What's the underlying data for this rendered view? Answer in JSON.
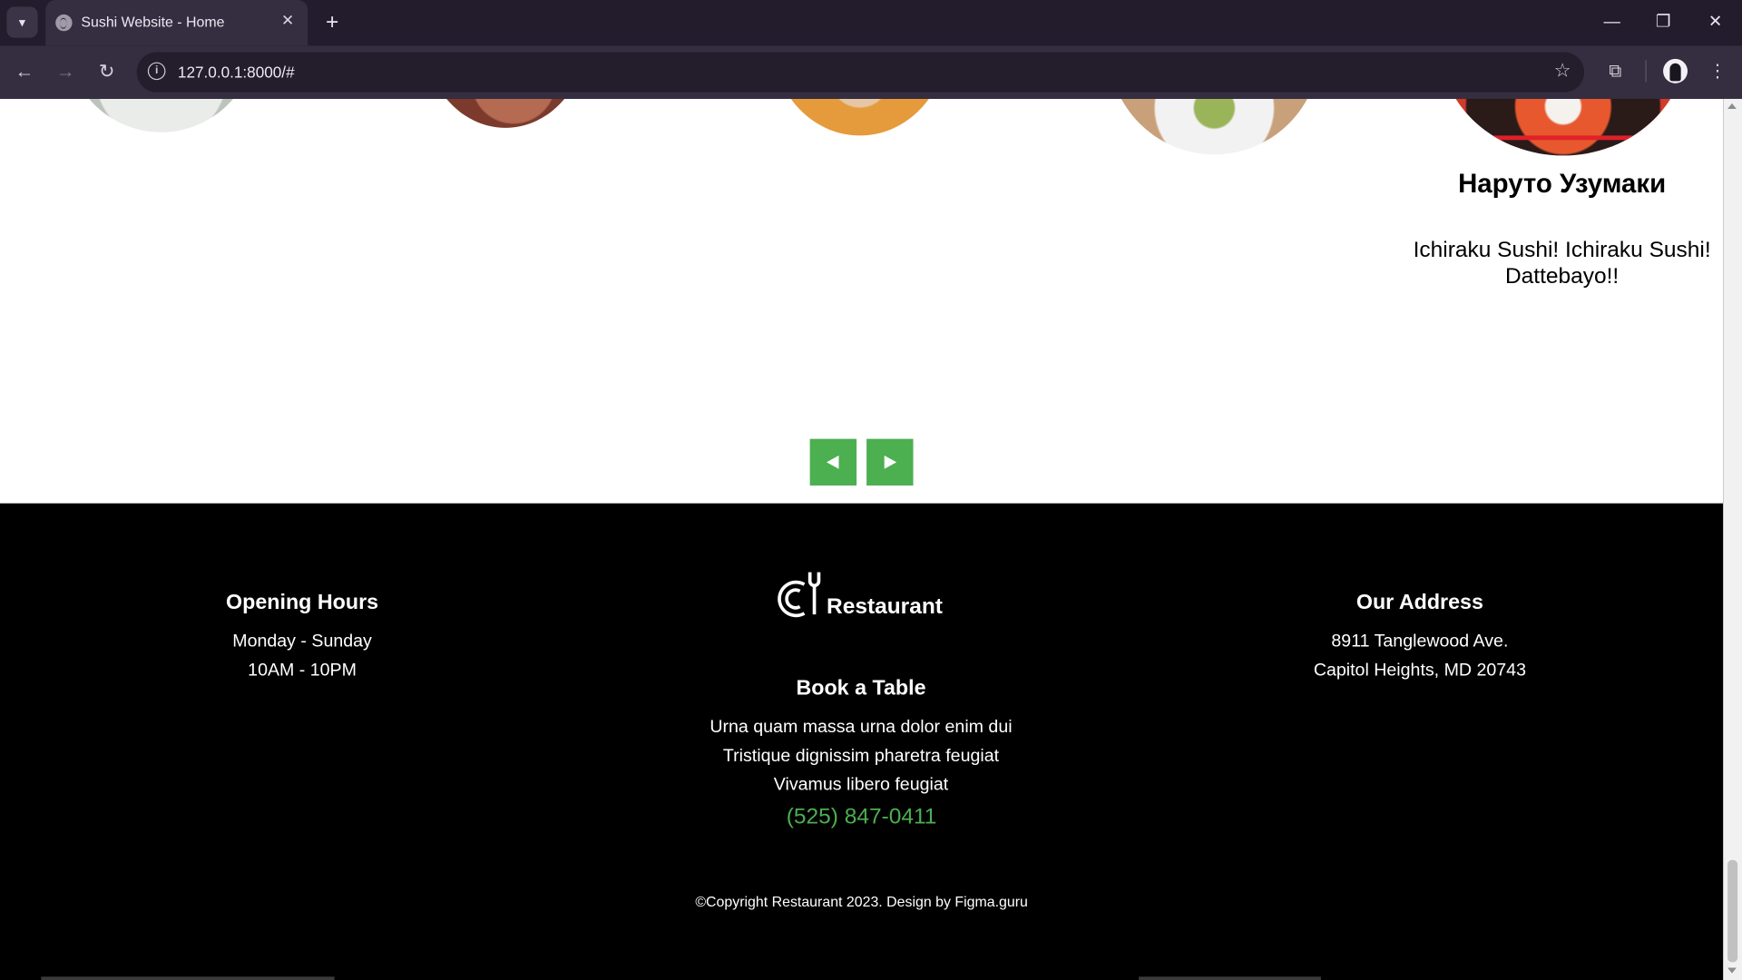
{
  "browser": {
    "tab_title": "Sushi Website - Home",
    "tab_close": "✕",
    "new_tab": "+",
    "url": "127.0.0.1:8000/#",
    "window_controls": {
      "minimize": "—",
      "restore": "❐",
      "close": "✕"
    }
  },
  "testimonial": {
    "name": "Наруто Узумаки",
    "quote": "Ichiraku Sushi! Ichiraku Sushi! Dattebayo!!"
  },
  "slider": {
    "prev_icon": "triangle-left",
    "next_icon": "triangle-right",
    "accent": "#4caf50"
  },
  "footer": {
    "opening": {
      "title": "Opening Hours",
      "line1": "Monday - Sunday",
      "line2": "10AM - 10PM"
    },
    "logo_text": "Restaurant",
    "book": {
      "title": "Book a Table",
      "line1": "Urna quam massa urna dolor enim dui",
      "line2": "Tristique dignissim pharetra feugiat",
      "line3": "Vivamus libero feugiat",
      "phone": "(525) 847-0411"
    },
    "address": {
      "title": "Our Address",
      "line1": "8911 Tanglewood Ave.",
      "line2": "Capitol Heights, MD 20743"
    },
    "copyright": "©Copyright Restaurant 2023. Design by Figma.guru"
  }
}
